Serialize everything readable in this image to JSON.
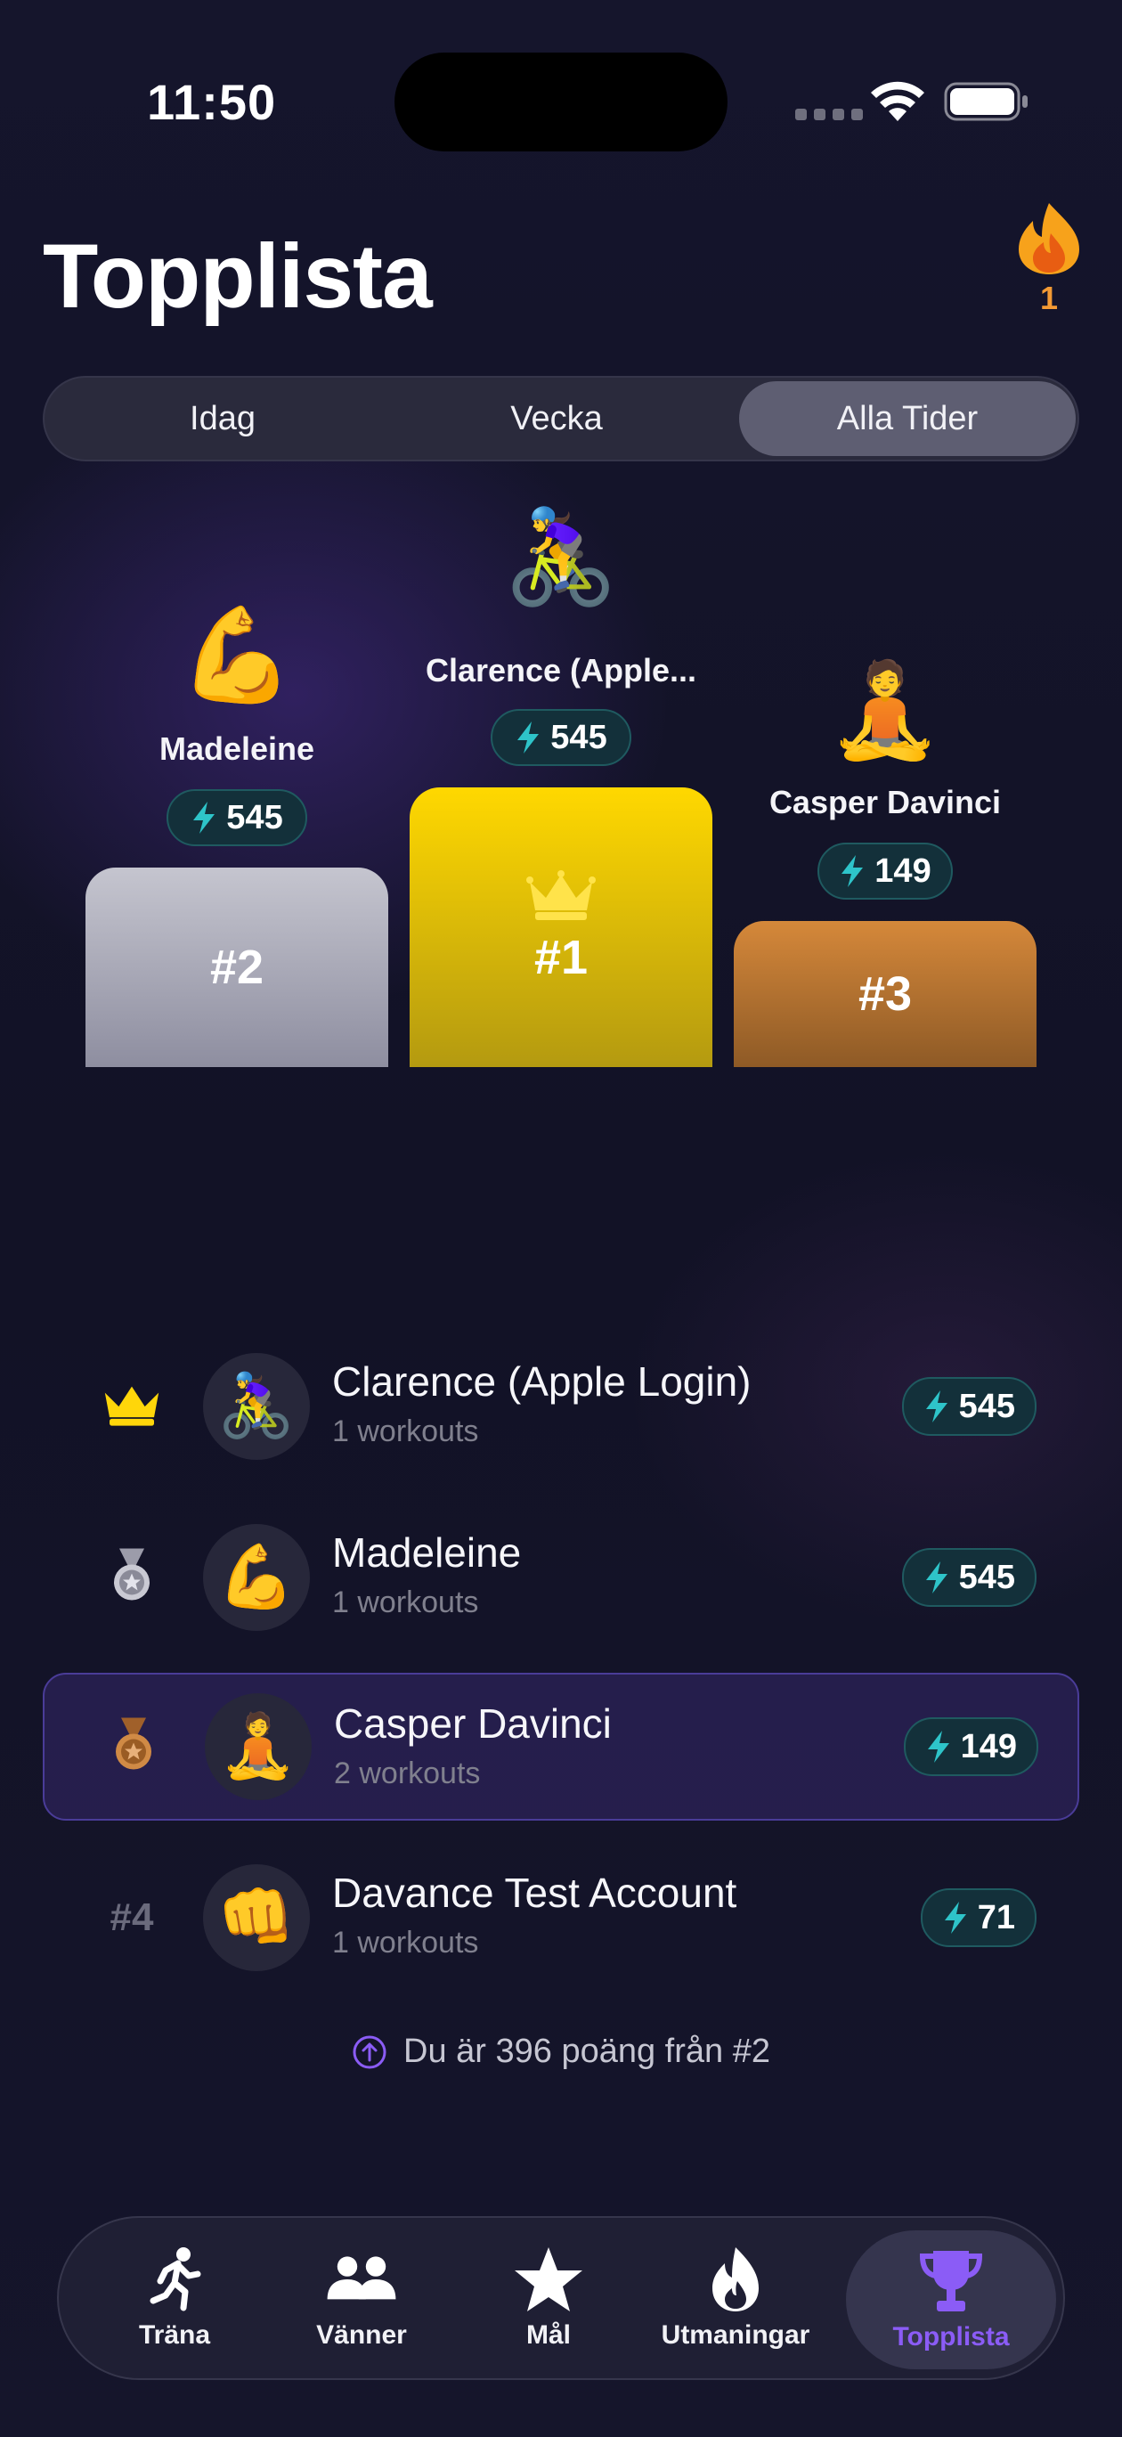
{
  "status_bar": {
    "time": "11:50"
  },
  "header": {
    "title": "Topplista",
    "streak_count": "1"
  },
  "tabs": [
    "Idag",
    "Vecka",
    "Alla Tider"
  ],
  "selected_tab": "Alla Tider",
  "podium": [
    {
      "place": "#2",
      "name": "Madeleine",
      "points": "545",
      "emoji": "💪",
      "color": "#b4b4c2"
    },
    {
      "place": "#1",
      "name": "Clarence (Apple...",
      "points": "545",
      "emoji": "🚴‍♀️",
      "color": "#f2cf00"
    },
    {
      "place": "#3",
      "name": "Casper Davinci",
      "points": "149",
      "emoji": "🧘",
      "color": "#c77a32"
    }
  ],
  "leaderboard": [
    {
      "rank_icon": "crown-icon",
      "name": "Clarence (Apple Login)",
      "subtitle": "1 workouts",
      "points": "545",
      "emoji": "🚴‍♀️"
    },
    {
      "rank_icon": "silver-medal-icon",
      "name": "Madeleine",
      "subtitle": "1 workouts",
      "points": "545",
      "emoji": "💪"
    },
    {
      "rank_icon": "bronze-medal-icon",
      "name": "Casper Davinci",
      "subtitle": "2 workouts",
      "points": "149",
      "emoji": "🧘",
      "highlighted": true
    },
    {
      "rank_text": "#4",
      "name": "Davance Test Account",
      "subtitle": "1 workouts",
      "points": "71",
      "emoji": "👊"
    }
  ],
  "hint": "Du är 396 poäng från #2",
  "tab_bar": [
    {
      "label": "Träna",
      "icon": "running-icon"
    },
    {
      "label": "Vänner",
      "icon": "friends-icon"
    },
    {
      "label": "Mål",
      "icon": "star-icon"
    },
    {
      "label": "Utmaningar",
      "icon": "flame-icon"
    },
    {
      "label": "Topplista",
      "icon": "trophy-icon",
      "active": true
    }
  ],
  "colors": {
    "accent": "#8b5cf6",
    "points_pill": "#13303a",
    "bolt": "#2ec4c9",
    "streak": "#f39a34"
  }
}
